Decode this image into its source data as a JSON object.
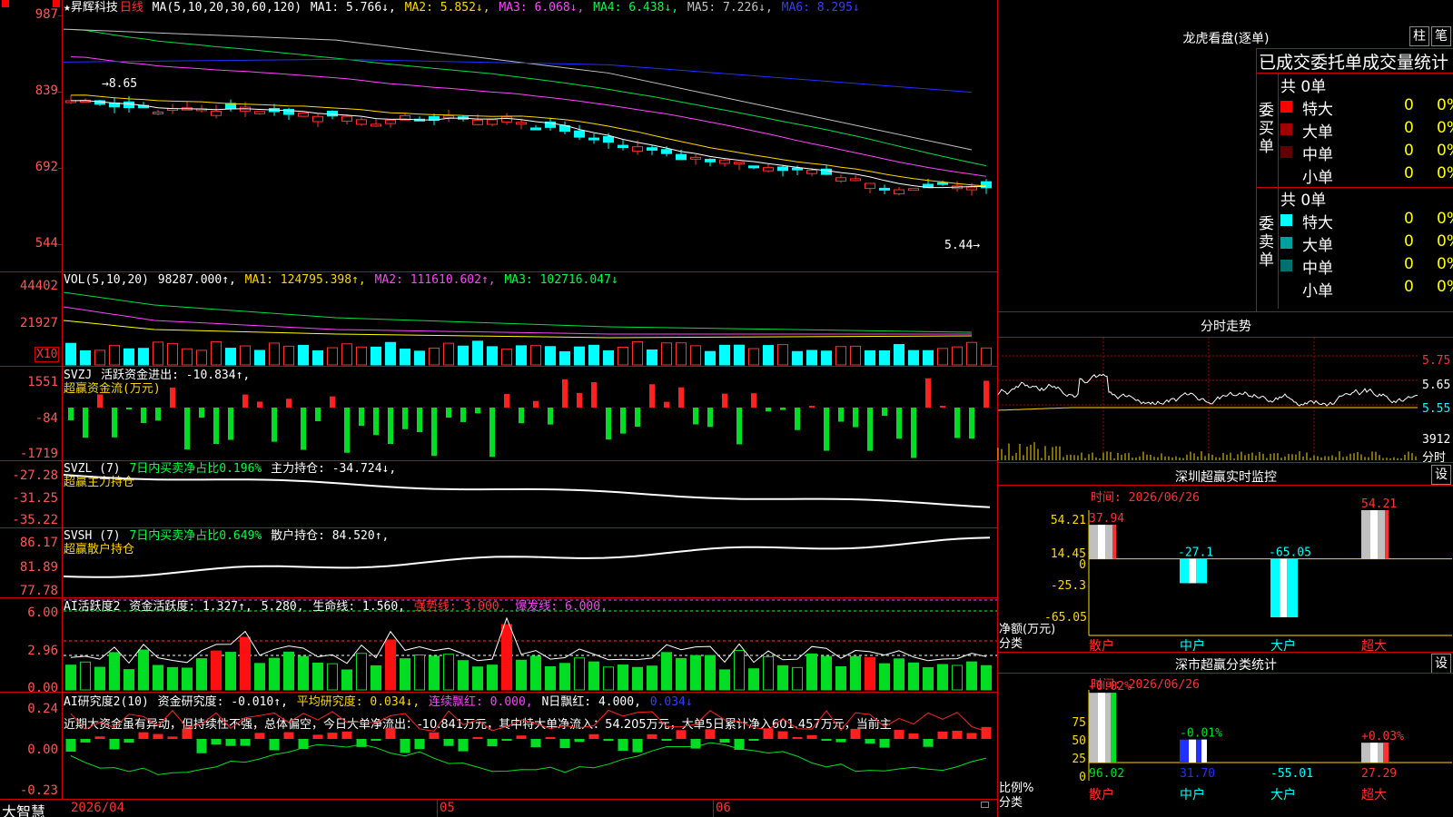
{
  "main_panel": {
    "legend": {
      "stock_name": "★昇辉科技",
      "period": "日线",
      "ma_def": "MA(5,10,20,30,60,120)",
      "ma1": "MA1: 5.766↓,",
      "ma2": "MA2: 5.852↓,",
      "ma3": "MA3: 6.068↓,",
      "ma4": "MA4: 6.438↓,",
      "ma5": "MA5: 7.226↓,",
      "ma6": "MA6: 8.295↓"
    },
    "y_labels": [
      "987",
      "839",
      "692",
      "544"
    ],
    "high_label": "8.65",
    "low_label": "5.44",
    "low_arrow": "5.44→",
    "colors": {
      "up": "#ff3030",
      "down": "#00ffff"
    }
  },
  "vol_panel": {
    "legend": {
      "name": "VOL(5,10,20)",
      "value": "98287.000↑,",
      "ma1": "MA1: 124795.398↑,",
      "ma2": "MA2: 111610.602↑,",
      "ma3": "MA3: 102716.047↓"
    },
    "y_labels": [
      "44402",
      "21927"
    ],
    "unit": "X10"
  },
  "svzj_panel": {
    "legend": {
      "name": "SVZJ",
      "value": "活跃资金进出: -10.834↑,",
      "title": "超赢资金流(万元)"
    },
    "y_labels": [
      "1551",
      "-84",
      "-1719"
    ]
  },
  "svzl_panel": {
    "legend": {
      "name": "SVZL (7)",
      "ratio": "7日内买卖净占比0.196%",
      "value": "主力持仓: -34.724↓,",
      "title": "超赢主力持仓"
    },
    "y_labels": [
      "-27.28",
      "-31.25",
      "-35.22"
    ]
  },
  "svsh_panel": {
    "legend": {
      "name": "SVSH (7)",
      "ratio": "7日内买卖净占比0.649%",
      "value": "散户持仓: 84.520↑,",
      "title": "超赢散户持仓"
    },
    "y_labels": [
      "86.17",
      "81.89",
      "77.78"
    ]
  },
  "ai_active_panel": {
    "legend": {
      "name": "AI活跃度2",
      "value": "资金活跃度: 1.327↑,",
      "v2": "5.280,",
      "life": "生命线: 1.560,",
      "strong": "强势线: 3.000,",
      "burst": "爆发线: 6.000,"
    },
    "y_labels": [
      "6.00",
      "2.96",
      "0.00"
    ]
  },
  "ai_research_panel": {
    "legend": {
      "name": "AI研究度2(10)",
      "value": "资金研究度: -0.010↑,",
      "avg": "平均研究度: 0.034↓,",
      "red": "连续飘红: 0.000,",
      "nred": "N日飘红: 4.000,",
      "last": "0.034↓"
    },
    "comment": "近期大资金虽有异动，但持续性不强，总体偏空，今日大单净流出：-10.841万元，其中特大单净流入：54.205万元，大单5日累计净入601.457万元，当前主",
    "y_labels": [
      "0.24",
      "0.00",
      "-0.23"
    ]
  },
  "x_axis": {
    "labels": [
      "2026/04",
      "05",
      "06"
    ],
    "brand": "大智慧"
  },
  "right_panel": {
    "dragon_title": "龙虎看盘(逐单)",
    "btn_bar": "柱",
    "btn_pen": "笔",
    "stats_title": "已成交委托单成交量统计",
    "buy": {
      "label": "委买单",
      "total": "共 0单",
      "rows": [
        {
          "name": "特大",
          "count": "0",
          "pct": "0%",
          "color": "#ff0000"
        },
        {
          "name": "大单",
          "count": "0",
          "pct": "0%",
          "color": "#a00000"
        },
        {
          "name": "中单",
          "count": "0",
          "pct": "0%",
          "color": "#600000"
        },
        {
          "name": "小单",
          "count": "0",
          "pct": "0%",
          "color": "#000000"
        }
      ]
    },
    "sell": {
      "label": "委卖单",
      "total": "共 0单",
      "rows": [
        {
          "name": "特大",
          "count": "0",
          "pct": "0%",
          "color": "#00ffff"
        },
        {
          "name": "大单",
          "count": "0",
          "pct": "0%",
          "color": "#00a0a0"
        },
        {
          "name": "中单",
          "count": "0",
          "pct": "0%",
          "color": "#007070"
        },
        {
          "name": "小单",
          "count": "0",
          "pct": "0%",
          "color": "#000000"
        }
      ]
    },
    "intraday": {
      "title": "分时走势",
      "y_labels": [
        "5.75",
        "5.65",
        "5.55"
      ],
      "vol_label": "3912",
      "unit_label": "分时"
    },
    "monitor": {
      "title": "深圳超赢实时监控",
      "set": "设",
      "date_label": "时间: 2026/06/26",
      "y_labels": [
        "54.21",
        "14.45",
        "0",
        "-25.3",
        "-65.05"
      ],
      "axis_caption1": "净额(万元)",
      "axis_caption2": "分类",
      "categories": [
        "散户",
        "中户",
        "大户",
        "超大"
      ],
      "values": [
        37.94,
        -27.1,
        -65.05,
        54.21
      ],
      "value_labels": [
        "37.94",
        "-27.1",
        "-65.05",
        "54.21"
      ]
    },
    "classify": {
      "title": "深市超赢分类统计",
      "set": "设",
      "date_label": "时间: 2026/06/26",
      "y_labels": [
        "75",
        "50",
        "25",
        "0"
      ],
      "axis_caption1": "比例%",
      "axis_caption2": "分类",
      "categories": [
        "散户",
        "中户",
        "大户",
        "超大"
      ],
      "pct_labels": [
        "+0.02%",
        "-0.01%",
        "",
        "+0.03%"
      ],
      "values": [
        96.02,
        31.7,
        -55.01,
        27.29
      ],
      "value_labels": [
        "96.02",
        "31.70",
        "-55.01",
        "27.29"
      ]
    }
  }
}
